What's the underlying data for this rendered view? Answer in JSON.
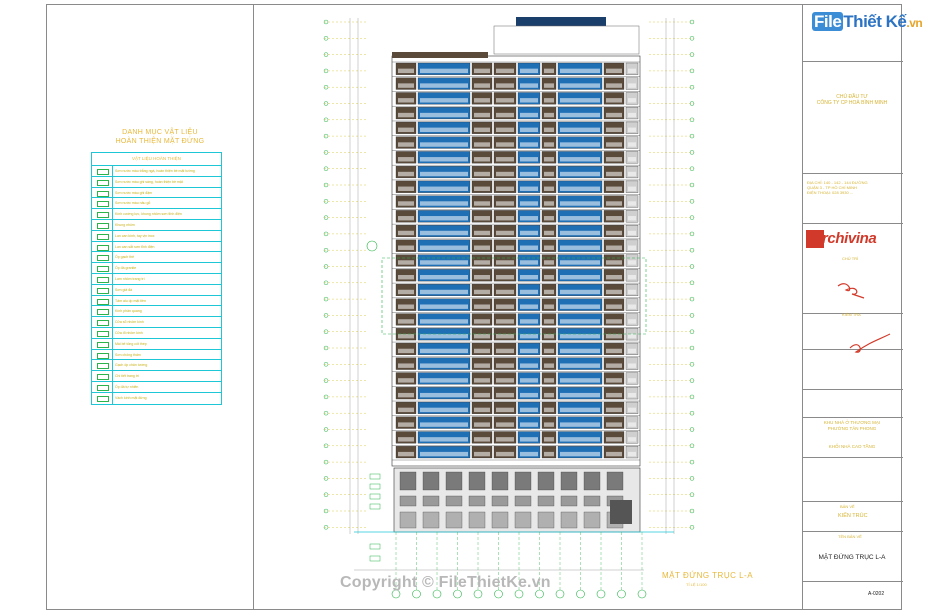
{
  "watermark": "Copyright © FileThietKe.vn",
  "logo": {
    "file": "File",
    "brand": "Thiết Kế",
    "domain": ".vn"
  },
  "left_panel": {
    "title_line1": "DANH MỤC VẬT LIỆU",
    "title_line2": "HOÀN THIỆN MẶT ĐỨNG",
    "table_header": "VẬT LIỆU HOÀN THIỆN",
    "rows": [
      "Sơn nước màu trắng ngà, hoàn thiện bề mặt tường",
      "Sơn nước màu ghi sáng, hoàn thiện bề mặt",
      "Sơn nước màu ghi đậm",
      "Sơn nước màu nâu gỗ",
      "Kính cường lực, khung nhôm sơn tĩnh điện",
      "Khung nhôm",
      "Lan can kính, tay vịn inox",
      "Lan can sắt sơn tĩnh điện",
      "Ốp gạch thẻ",
      "Ốp đá granite",
      "Lam nhôm trang trí",
      "Sơn giả đá",
      "Tấm alu ốp mặt tiền",
      "Kính phản quang",
      "Cửa sổ nhôm kính",
      "Cửa đi nhôm kính",
      "Mái bê tông cốt thép",
      "Sơn chống thấm",
      "Gạch ốp chân tường",
      "Chi tiết trang trí",
      "Ốp đá tự nhiên",
      "Vách kính mặt đứng"
    ]
  },
  "drawing": {
    "caption": "MẶT ĐỨNG TRỤC L-A",
    "caption_scale": "TỈ LỆ 1/100",
    "colors": {
      "brown": "#5a4a3a",
      "blue": "#1f6fb5",
      "dark_blue": "#1a3f6b",
      "grey": "#8a8a8a",
      "green_line": "#2bb44a",
      "cyan": "#1ec7d6",
      "yellow": "#d6c21f"
    }
  },
  "title_block": {
    "client_label": "CHỦ ĐẦU TƯ",
    "client_name": "CÔNG TY CP HOÀ BÌNH MINH",
    "company_lines": [
      "ĐỊA CHỈ: 140 - 142 - 144 ĐƯỜNG",
      "QUẬN 3 - TP HỒ CHÍ MINH",
      "ĐIỆN THOẠI: 028 3930 ..."
    ],
    "brand": "rchivina",
    "role_1": "CHỦ TRÌ",
    "role_2": "KIỂM TRA",
    "project_line1": "KHU NHÀ Ở THƯƠNG MẠI",
    "project_line2": "PHƯỜNG TÂN PHONG",
    "project_line3": "KHỐI NHÀ CAO TẦNG",
    "phase_label": "BẢN VẼ",
    "phase_value": "KIẾN TRÚC",
    "sheet_label": "TÊN BẢN VẼ",
    "drawing_title": "MẶT ĐỨNG TRỤC L-A",
    "drawing_code": "A-0202"
  }
}
